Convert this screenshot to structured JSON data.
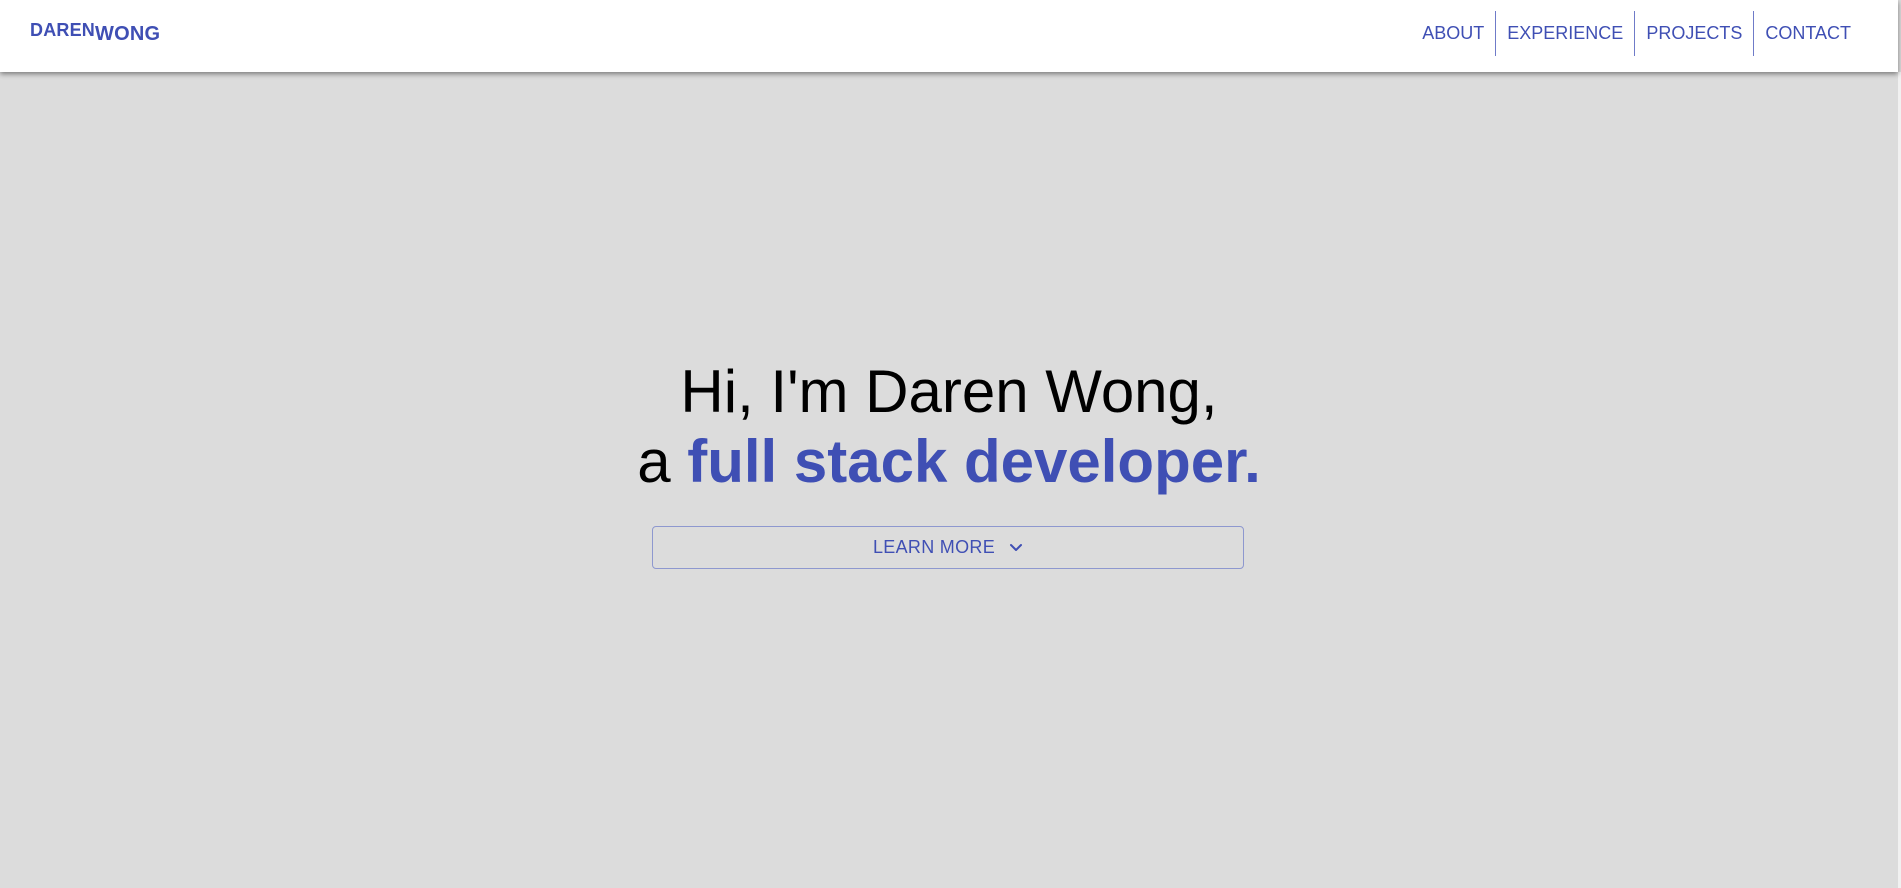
{
  "brand": {
    "first": "DAREN",
    "second": "WONG",
    "color": "#3f4fb4"
  },
  "nav": {
    "items": [
      "ABOUT",
      "EXPERIENCE",
      "PROJECTS",
      "CONTACT"
    ]
  },
  "hero": {
    "line1": "Hi, I'm Daren Wong,",
    "line2_prefix": "a ",
    "line2_accent": "full stack developer.",
    "button_label": "LEARN MORE",
    "button_icon": "chevron-down-icon"
  },
  "colors": {
    "background": "#dcdcdc",
    "accent": "#3f4fb4",
    "navbar": "#ffffff"
  }
}
